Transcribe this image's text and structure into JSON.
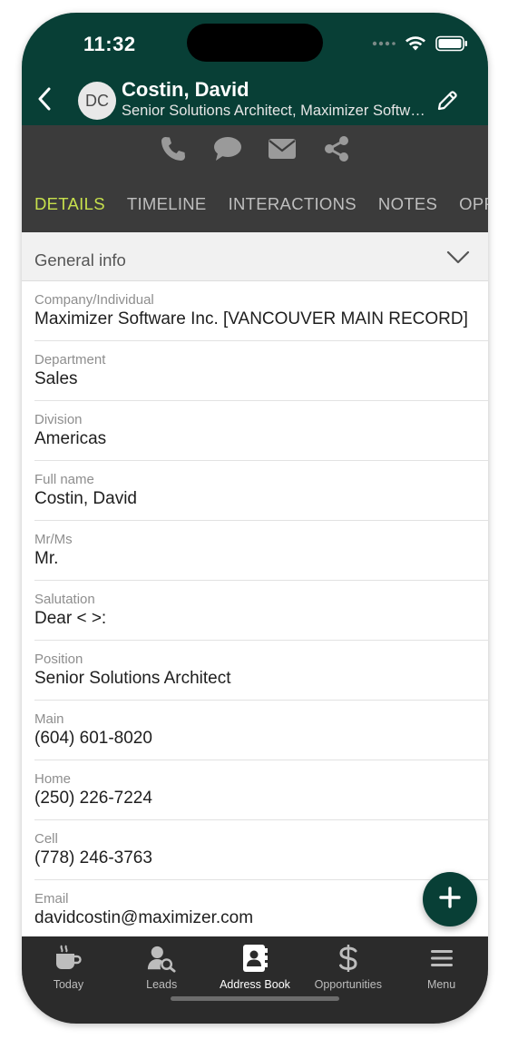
{
  "status": {
    "time": "11:32"
  },
  "header": {
    "avatar_initials": "DC",
    "name": "Costin, David",
    "subtitle": "Senior Solutions Architect, Maximizer Software Inc."
  },
  "actions": [
    "phone-icon",
    "chat-icon",
    "email-icon",
    "share-icon"
  ],
  "tabs": [
    {
      "label": "DETAILS",
      "active": true
    },
    {
      "label": "TIMELINE",
      "active": false
    },
    {
      "label": "INTERACTIONS",
      "active": false
    },
    {
      "label": "NOTES",
      "active": false
    },
    {
      "label": "OPPO",
      "active": false
    }
  ],
  "section": {
    "title": "General info"
  },
  "fields": [
    {
      "label": "Company/Individual",
      "value": "Maximizer Software Inc. [VANCOUVER MAIN RECORD]"
    },
    {
      "label": "Department",
      "value": "Sales"
    },
    {
      "label": "Division",
      "value": "Americas"
    },
    {
      "label": "Full name",
      "value": "Costin, David"
    },
    {
      "label": "Mr/Ms",
      "value": "Mr."
    },
    {
      "label": "Salutation",
      "value": "Dear < >:"
    },
    {
      "label": "Position",
      "value": "Senior Solutions Architect"
    },
    {
      "label": "Main",
      "value": "(604) 601-8020"
    },
    {
      "label": "Home",
      "value": "(250) 226-7224"
    },
    {
      "label": "Cell",
      "value": "(778) 246-3763"
    },
    {
      "label": "Email",
      "value": "davidcostin@maximizer.com"
    }
  ],
  "bottom_nav": [
    {
      "label": "Today",
      "icon": "coffee-cup-icon",
      "active": false
    },
    {
      "label": "Leads",
      "icon": "leads-search-icon",
      "active": false
    },
    {
      "label": "Address Book",
      "icon": "address-book-icon",
      "active": true
    },
    {
      "label": "Opportunities",
      "icon": "dollar-icon",
      "active": false
    },
    {
      "label": "Menu",
      "icon": "hamburger-menu-icon",
      "active": false
    }
  ],
  "colors": {
    "header_bg": "#083f36",
    "action_bar_bg": "#3b3b3b",
    "active_tab": "#c7e04c",
    "fab_bg": "#083f36",
    "nav_bg": "#2b2b2b"
  }
}
